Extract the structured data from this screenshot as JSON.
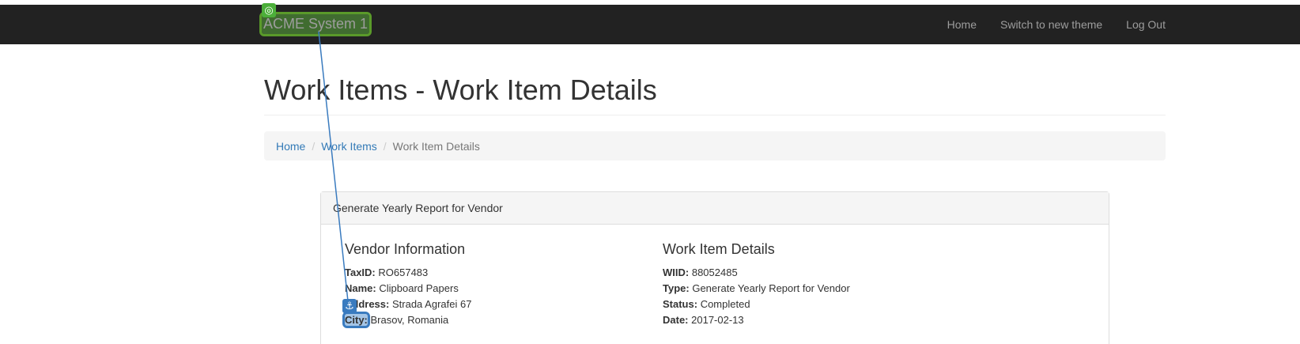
{
  "navbar": {
    "brand": "ACME System 1",
    "links": [
      "Home",
      "Switch to new theme",
      "Log Out"
    ]
  },
  "page": {
    "title": "Work Items - Work Item Details"
  },
  "breadcrumb": {
    "items": [
      "Home",
      "Work Items",
      "Work Item Details"
    ],
    "separator": "/"
  },
  "panel": {
    "heading": "Generate Yearly Report for Vendor",
    "vendor": {
      "title": "Vendor Information",
      "taxid_label": "TaxID:",
      "taxid": "RO657483",
      "name_label": "Name:",
      "name": "Clipboard Papers",
      "address_label": "Address:",
      "address": "Strada Agrafei 67",
      "city_label": "City:",
      "city": "Brasov, Romania"
    },
    "details": {
      "title": "Work Item Details",
      "wiid_label": "WIID:",
      "wiid": "88052485",
      "type_label": "Type:",
      "type": "Generate Yearly Report for Vendor",
      "status_label": "Status:",
      "status": "Completed",
      "date_label": "Date:",
      "date": "2017-02-13"
    }
  },
  "annotations": {
    "target_icon": "target-icon",
    "anchor_icon": "anchor-icon",
    "source_color": "#4caf3a",
    "target_color": "#3a7bbf"
  }
}
